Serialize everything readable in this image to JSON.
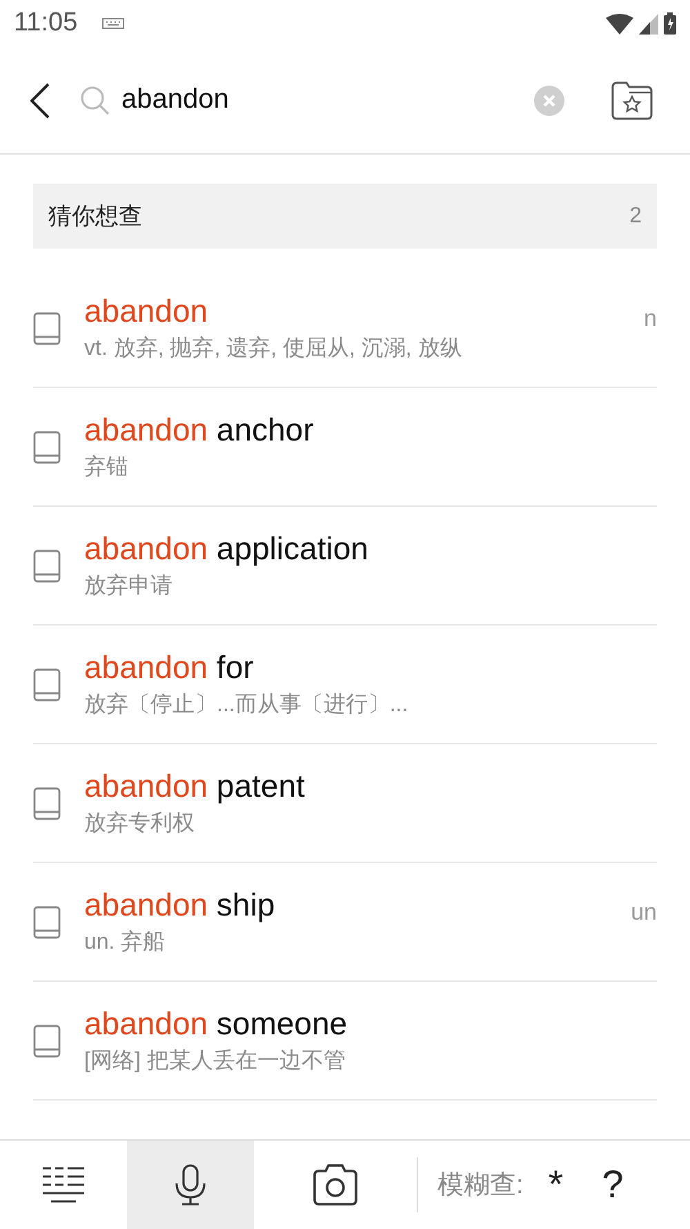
{
  "status_bar": {
    "time": "11:05"
  },
  "search": {
    "value": "abandon"
  },
  "section": {
    "title": "猜你想查",
    "count": "2"
  },
  "results": [
    {
      "match": "abandon",
      "definition": "vt. 放弃, 抛弃, 遗弃, 使屈从, 沉溺, 放纵",
      "tag": "n"
    },
    {
      "match": "abandon",
      "rest": "anchor",
      "definition": "弃锚"
    },
    {
      "match": "abandon",
      "rest": "application",
      "definition": "放弃申请"
    },
    {
      "match": "abandon",
      "rest": "for",
      "definition": "放弃〔停止〕...而从事〔进行〕..."
    },
    {
      "match": "abandon",
      "rest": "patent",
      "definition": "放弃专利权"
    },
    {
      "match": "abandon",
      "rest": "ship",
      "definition": "un. 弃船",
      "tag": "un"
    },
    {
      "match": "abandon",
      "rest": "someone",
      "definition": "[网络] 把某人丢在一边不管"
    }
  ],
  "toolbar": {
    "buttons": [
      {
        "kind": "list",
        "selected": false
      },
      {
        "kind": "mic",
        "selected": true
      },
      {
        "kind": "camera",
        "selected": false
      }
    ],
    "fuzzy_label": "模糊查:",
    "keys": [
      "*",
      "?"
    ]
  }
}
